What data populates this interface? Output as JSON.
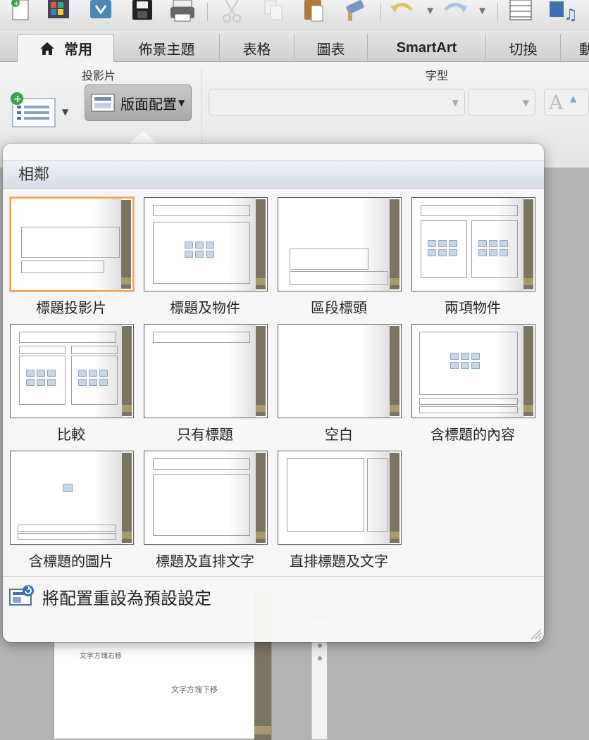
{
  "tabs": [
    {
      "label": "常用",
      "active": true
    },
    {
      "label": "佈景主題"
    },
    {
      "label": "表格"
    },
    {
      "label": "圖表"
    },
    {
      "label": "SmartArt"
    },
    {
      "label": "切換"
    },
    {
      "label": "動"
    }
  ],
  "ribbon": {
    "group_slides": "投影片",
    "group_font": "字型",
    "layout_button": "版面配置",
    "font_size_up": "A"
  },
  "popup": {
    "section_title": "相鄰",
    "layouts": [
      {
        "label": "標題投影片",
        "selected": true
      },
      {
        "label": "標題及物件"
      },
      {
        "label": "區段標頭"
      },
      {
        "label": "兩項物件"
      },
      {
        "label": "比較"
      },
      {
        "label": "只有標題"
      },
      {
        "label": "空白"
      },
      {
        "label": "含標題的內容"
      },
      {
        "label": "含標題的圖片"
      },
      {
        "label": "標題及直排文字"
      },
      {
        "label": "直排標題及文字"
      }
    ],
    "reset_label": "將配置重設為預設設定"
  },
  "background": {
    "slide_text_1": "文字方塊右移",
    "slide_text_2": "文字方塊下移"
  },
  "colors": {
    "accent_bar": "#7c7462",
    "accent_bar_light": "#a79b6d",
    "selected_border": "#f0a15a"
  }
}
